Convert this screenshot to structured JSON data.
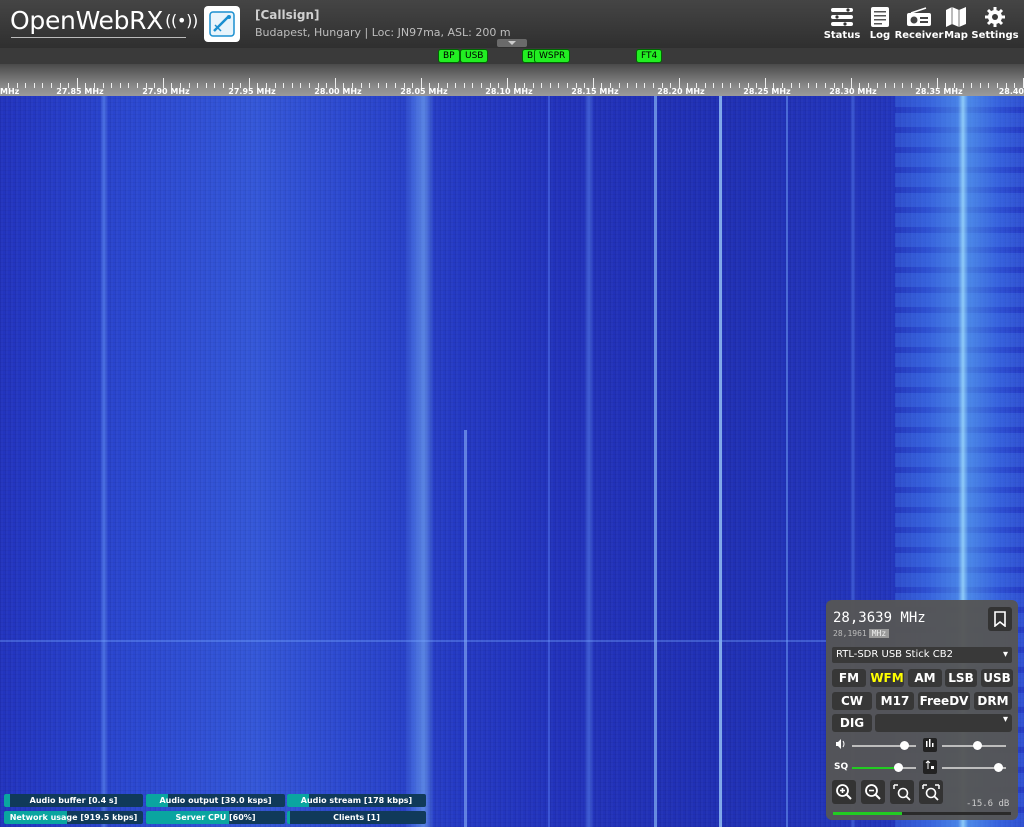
{
  "header": {
    "logo_text": "OpenWebRX",
    "receiver_name": "[Callsign]",
    "receiver_desc": "Budapest, Hungary | Loc: JN97ma, ASL: 200 m",
    "nav": [
      {
        "label": "Status",
        "icon": "status-icon"
      },
      {
        "label": "Log",
        "icon": "log-icon"
      },
      {
        "label": "Receiver",
        "icon": "receiver-icon"
      },
      {
        "label": "Map",
        "icon": "map-icon"
      },
      {
        "label": "Settings",
        "icon": "settings-icon"
      }
    ]
  },
  "bookmarks": [
    "BP",
    "USB",
    "B",
    "WSPR",
    "FT4"
  ],
  "scale_labels": [
    "MHz",
    "27.85 MHz",
    "27.90 MHz",
    "27.95 MHz",
    "28.00 MHz",
    "28.05 MHz",
    "28.10 MHz",
    "28.15 MHz",
    "28.20 MHz",
    "28.25 MHz",
    "28.30 MHz",
    "28.35 MHz",
    "28.40"
  ],
  "panel": {
    "frequency": "28,3639 MHz",
    "center_frequency": "28,1961",
    "center_unit": "MHz",
    "sdr_profile": "RTL-SDR USB Stick CB2",
    "modes_row1": [
      "FM",
      "WFM",
      "AM",
      "LSB",
      "USB"
    ],
    "modes_row2": [
      "CW",
      "M17",
      "FreeDV",
      "DRM"
    ],
    "mode_dig": "DIG",
    "active_mode": "WFM",
    "squelch_label": "SQ",
    "volume_level": 0.82,
    "nr_level": 0.55,
    "squelch_level": 0.72,
    "agc_level": 0.88,
    "db_readout": "-15.6 dB",
    "smeter_level": 0.39
  },
  "status_bars": [
    {
      "label": "Audio buffer [0.4 s]",
      "level": 0.04
    },
    {
      "label": "Audio output [39.0 ksps]",
      "level": 0.16
    },
    {
      "label": "Audio stream [178 kbps]",
      "level": 0.16
    },
    {
      "label": "Network usage [919.5 kbps]",
      "level": 0.45
    },
    {
      "label": "Server CPU [60%]",
      "level": 0.6
    },
    {
      "label": "Clients [1]",
      "level": 0.02
    }
  ],
  "colors": {
    "waterfall_base": "#2233be",
    "bookmark_green": "#22ee22",
    "passband_yellow": "#ffff00",
    "active_mode": "#ffff00",
    "status_fill": "#0aa5a0"
  }
}
